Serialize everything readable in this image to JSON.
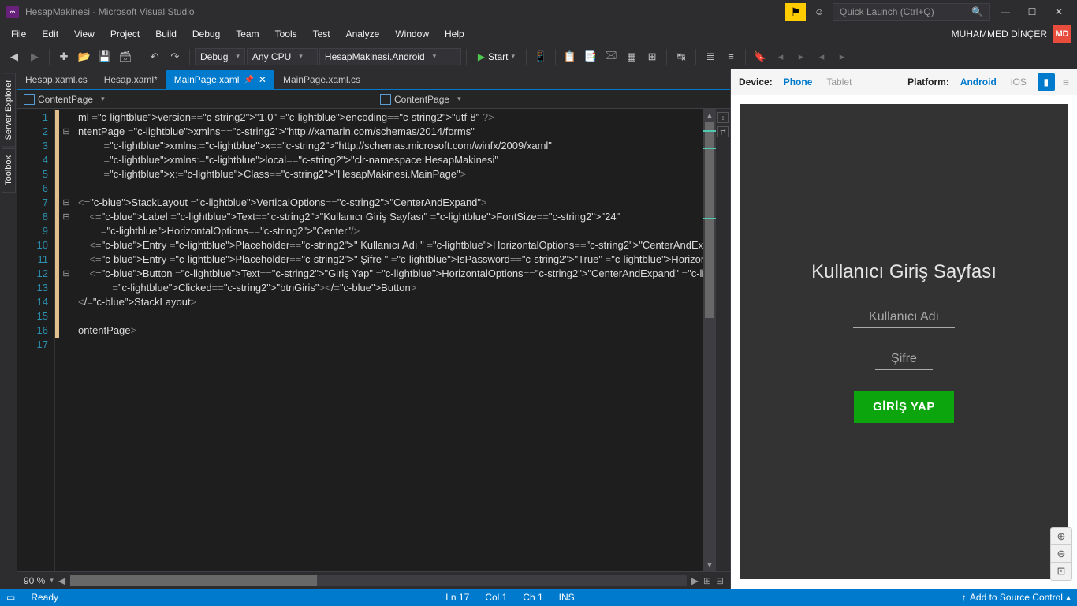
{
  "title": "HesapMakinesi - Microsoft Visual Studio",
  "quicklaunch_placeholder": "Quick Launch (Ctrl+Q)",
  "menus": [
    "File",
    "Edit",
    "View",
    "Project",
    "Build",
    "Debug",
    "Team",
    "Tools",
    "Test",
    "Analyze",
    "Window",
    "Help"
  ],
  "user": {
    "name": "MUHAMMED DİNÇER",
    "initials": "MD"
  },
  "toolbar": {
    "config": "Debug",
    "platform": "Any CPU",
    "startup": "HesapMakinesi.Android",
    "start": "Start"
  },
  "tabs": [
    {
      "label": "Hesap.xaml.cs",
      "active": false,
      "dirty": false
    },
    {
      "label": "Hesap.xaml*",
      "active": false,
      "dirty": true
    },
    {
      "label": "MainPage.xaml",
      "active": true,
      "dirty": false,
      "pinned": true
    },
    {
      "label": "MainPage.xaml.cs",
      "active": false,
      "dirty": false
    }
  ],
  "breadcrumb": {
    "left": "ContentPage",
    "right": "ContentPage"
  },
  "code": {
    "lines": [
      {
        "n": 1,
        "fold": "",
        "raw": "ml version=\"1.0\" encoding=\"utf-8\" ?>"
      },
      {
        "n": 2,
        "fold": "⊟",
        "raw": "ntentPage xmlns=\"http://xamarin.com/schemas/2014/forms\""
      },
      {
        "n": 3,
        "fold": "",
        "raw": "         xmlns:x=\"http://schemas.microsoft.com/winfx/2009/xaml\""
      },
      {
        "n": 4,
        "fold": "",
        "raw": "         xmlns:local=\"clr-namespace:HesapMakinesi\""
      },
      {
        "n": 5,
        "fold": "",
        "raw": "         x:Class=\"HesapMakinesi.MainPage\">"
      },
      {
        "n": 6,
        "fold": "",
        "raw": ""
      },
      {
        "n": 7,
        "fold": "⊟",
        "raw": "<StackLayout VerticalOptions=\"CenterAndExpand\">"
      },
      {
        "n": 8,
        "fold": "⊟",
        "raw": "    <Label Text=\"Kullanıcı Giriş Sayfası\" FontSize=\"24\""
      },
      {
        "n": 9,
        "fold": "",
        "raw": "        HorizontalOptions=\"Center\"/>"
      },
      {
        "n": 10,
        "fold": "",
        "raw": "    <Entry Placeholder=\" Kullanıcı Adı \" HorizontalOptions=\"CenterAndExpand\" x:Name=\"EKadi\"></Entry>"
      },
      {
        "n": 11,
        "fold": "",
        "raw": "    <Entry Placeholder=\" Şifre \" IsPassword=\"True\" HorizontalOptions=\"CenterAndExpand\" x:Name=\"ESifre\"></Entry>"
      },
      {
        "n": 12,
        "fold": "⊟",
        "raw": "    <Button Text=\"Giriş Yap\" HorizontalOptions=\"CenterAndExpand\" BackgroundColor=\"Green\""
      },
      {
        "n": 13,
        "fold": "",
        "raw": "            Clicked=\"btnGiris\"></Button>"
      },
      {
        "n": 14,
        "fold": "",
        "raw": "</StackLayout>"
      },
      {
        "n": 15,
        "fold": "",
        "raw": ""
      },
      {
        "n": 16,
        "fold": "",
        "raw": "ontentPage>"
      },
      {
        "n": 17,
        "fold": "",
        "raw": ""
      }
    ]
  },
  "editor_footer": {
    "zoom": "90 %"
  },
  "preview": {
    "device_label": "Device:",
    "device_opts": [
      "Phone",
      "Tablet"
    ],
    "device_active": "Phone",
    "platform_label": "Platform:",
    "platform_opts": [
      "Android",
      "iOS"
    ],
    "platform_active": "Android",
    "screen": {
      "title": "Kullanıcı Giriş Sayfası",
      "user_ph": "Kullanıcı Adı",
      "pass_ph": "Şifre",
      "button": "GİRİŞ YAP"
    }
  },
  "side": {
    "server": "Server Explorer",
    "toolbox": "Toolbox"
  },
  "status": {
    "ready": "Ready",
    "ln": "Ln 17",
    "col": "Col 1",
    "ch": "Ch 1",
    "ins": "INS",
    "source": "Add to Source Control"
  }
}
